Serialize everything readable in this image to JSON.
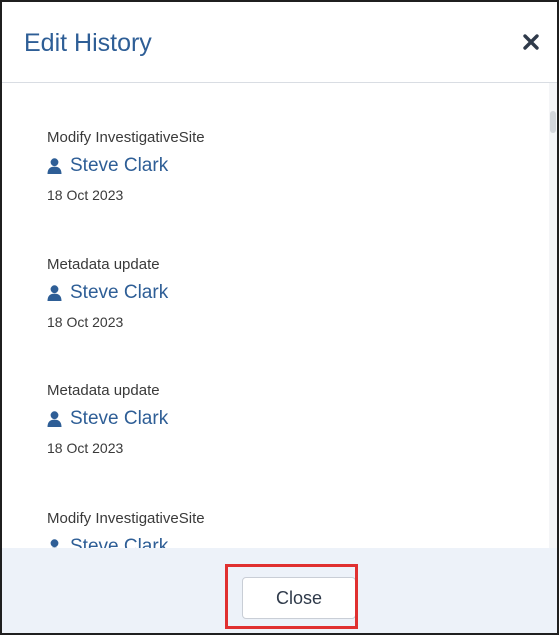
{
  "dialog": {
    "title": "Edit History",
    "close_icon": "close-x-icon",
    "close_button_label": "Close"
  },
  "entries": [
    {
      "action": "Modify InvestigativeSite",
      "user": "Steve Clark",
      "date": "18 Oct 2023"
    },
    {
      "action": "Metadata update",
      "user": "Steve Clark",
      "date": "18 Oct 2023"
    },
    {
      "action": "Metadata update",
      "user": "Steve Clark",
      "date": "18 Oct 2023"
    },
    {
      "action": "Modify InvestigativeSite",
      "user": "Steve Clark",
      "date": ""
    }
  ],
  "icons": {
    "user": "user-icon"
  },
  "colors": {
    "title": "#2e5e96",
    "link": "#2e5e96",
    "footer_bg": "#edf2f9",
    "highlight": "#e03030"
  }
}
